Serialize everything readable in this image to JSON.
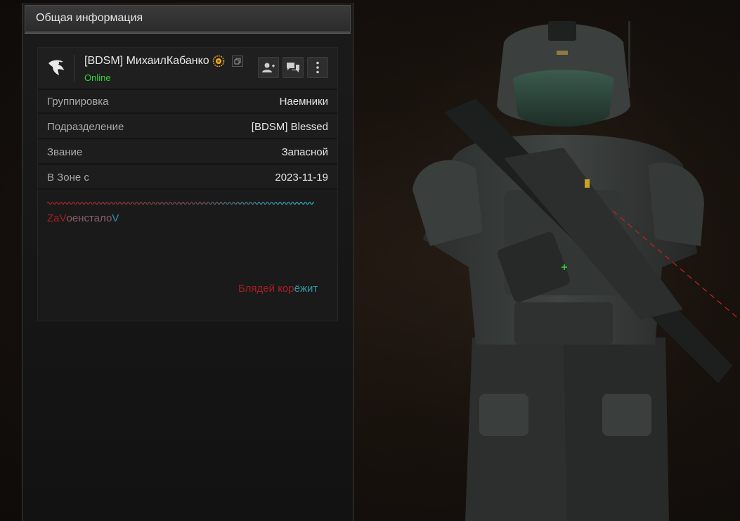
{
  "panel": {
    "title": "Общая информация"
  },
  "profile": {
    "name": "[BDSM] МихаилКабанко",
    "status": "Online",
    "status_color": "#37d23c",
    "logo_icon": "eagle-icon",
    "badge_icon": "sun-badge-icon",
    "actions": [
      {
        "icon": "add-friend-icon"
      },
      {
        "icon": "chat-icon"
      },
      {
        "icon": "more-vertical-icon"
      }
    ]
  },
  "details": [
    {
      "label": "Группировка",
      "value": "Наемники"
    },
    {
      "label": "Подразделение",
      "value": "[BDSM] Blessed"
    },
    {
      "label": "Звание",
      "value": "Запасной"
    },
    {
      "label": "В Зоне с",
      "value": "2023-11-19"
    }
  ],
  "about": {
    "motto_red": "ZaV",
    "motto_mixed": "оенстало",
    "motto_teal": "V",
    "curse_red": "Блядей кор",
    "curse_teal": "ёжит",
    "red_color": "#a81e24",
    "teal_color": "#2f97a6"
  }
}
